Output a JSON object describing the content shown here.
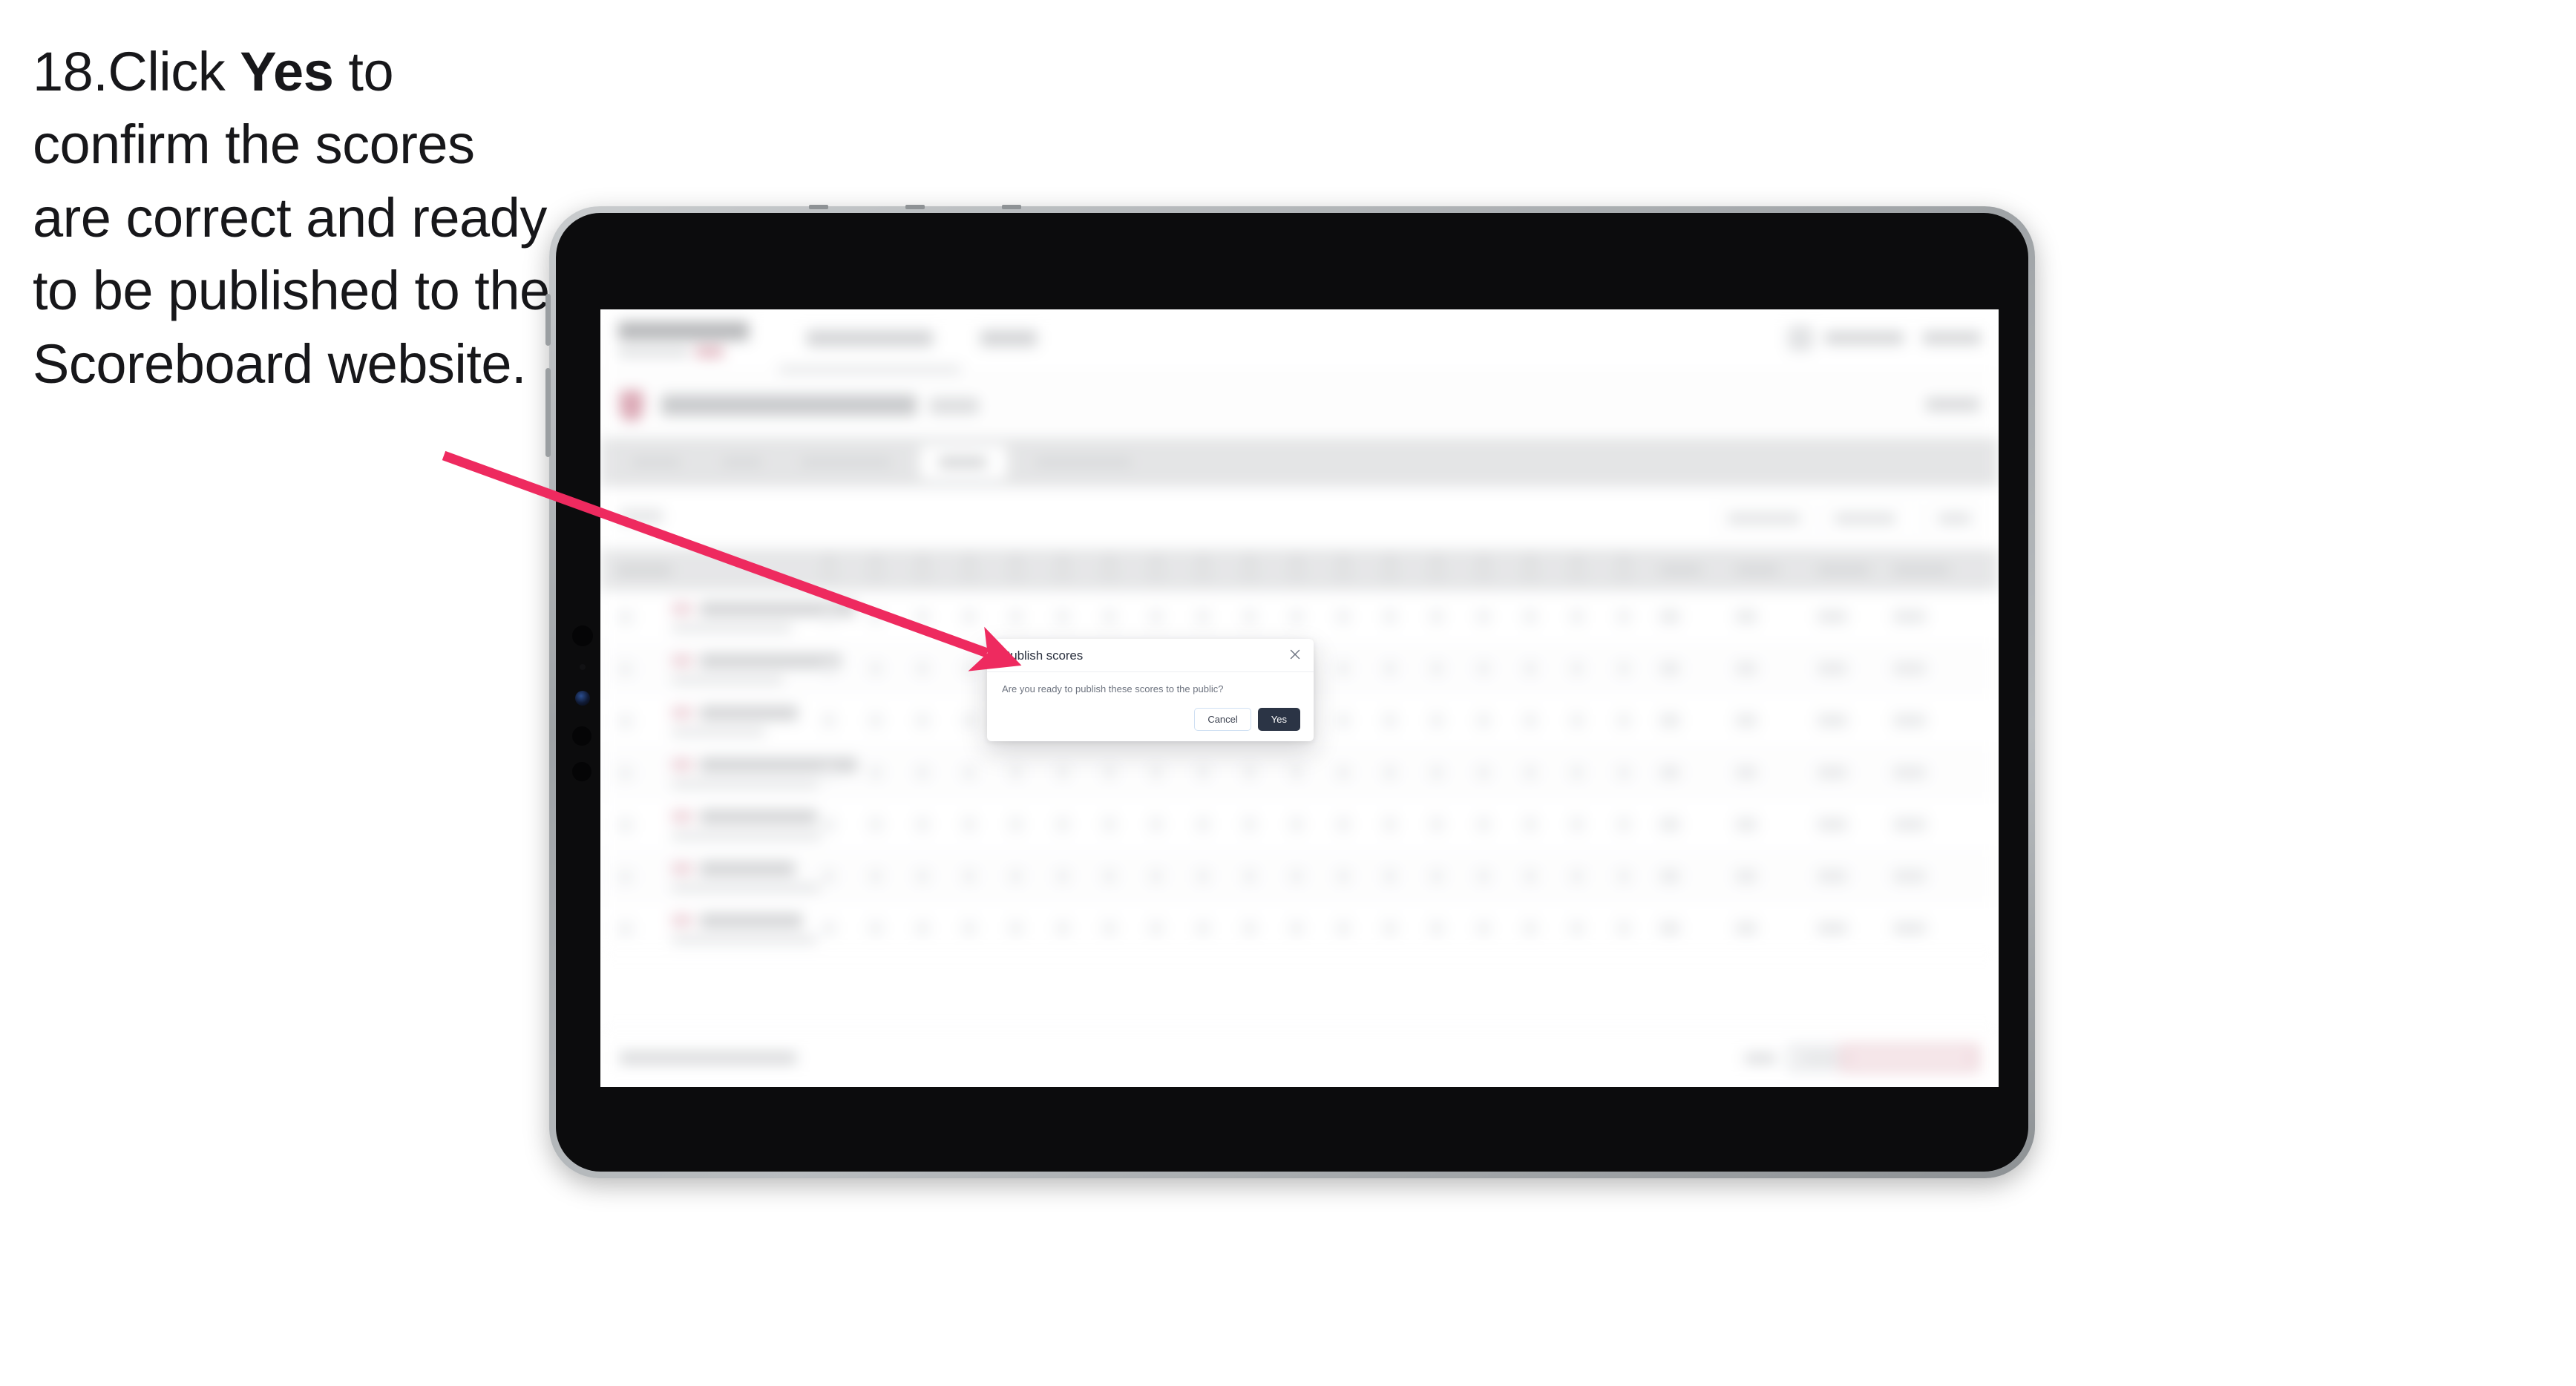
{
  "instruction": {
    "step_number": "18.",
    "pre": "Click ",
    "bold": "Yes",
    "post": " to confirm the scores are correct and ready to be published to the Scoreboard website."
  },
  "annotation": {
    "arrow_color": "#ee2a5f",
    "points_to": "publish-scores-dialog"
  },
  "device": {
    "type": "tablet",
    "frame_color": "#a8acaf",
    "bezel_color": "#0c0c0d"
  },
  "modal": {
    "title": "Publish scores",
    "body": "Are you ready to publish these scores to the public?",
    "close_icon": "close-icon",
    "cancel_label": "Cancel",
    "yes_label": "Yes",
    "yes_color": "#2b3445",
    "cancel_border_color": "#cfe0f3"
  },
  "background_app": {
    "state": "blurred",
    "note": "Scoreboard competition results screen, obscured behind modal",
    "topbar": {
      "brand": "",
      "nav_items": [
        "",
        ""
      ],
      "user": "",
      "sign_out": ""
    },
    "tabs": [
      {
        "label": "",
        "selected": false
      },
      {
        "label": "",
        "selected": false
      },
      {
        "label": "",
        "selected": false
      },
      {
        "label": "",
        "selected": true
      },
      {
        "label": "",
        "selected": false
      }
    ],
    "filters": [
      "",
      "",
      ""
    ],
    "table": {
      "first_column_header": "",
      "rows": [
        {
          "name": "",
          "sub": "",
          "name_w": 210,
          "sub_w": 162
        },
        {
          "name": "",
          "sub": "",
          "name_w": 190,
          "sub_w": 150
        },
        {
          "name": "",
          "sub": "",
          "name_w": 132,
          "sub_w": 126
        },
        {
          "name": "",
          "sub": "",
          "name_w": 212,
          "sub_w": 198
        },
        {
          "name": "",
          "sub": "",
          "name_w": 158,
          "sub_w": 202
        },
        {
          "name": "",
          "sub": "",
          "name_w": 128,
          "sub_w": 200
        },
        {
          "name": "",
          "sub": "",
          "name_w": 138,
          "sub_w": 196
        }
      ]
    },
    "bottombar": {
      "status": "",
      "link": "",
      "secondary_button": "",
      "primary_button": "",
      "primary_button_color": "#fbc9d4"
    }
  }
}
